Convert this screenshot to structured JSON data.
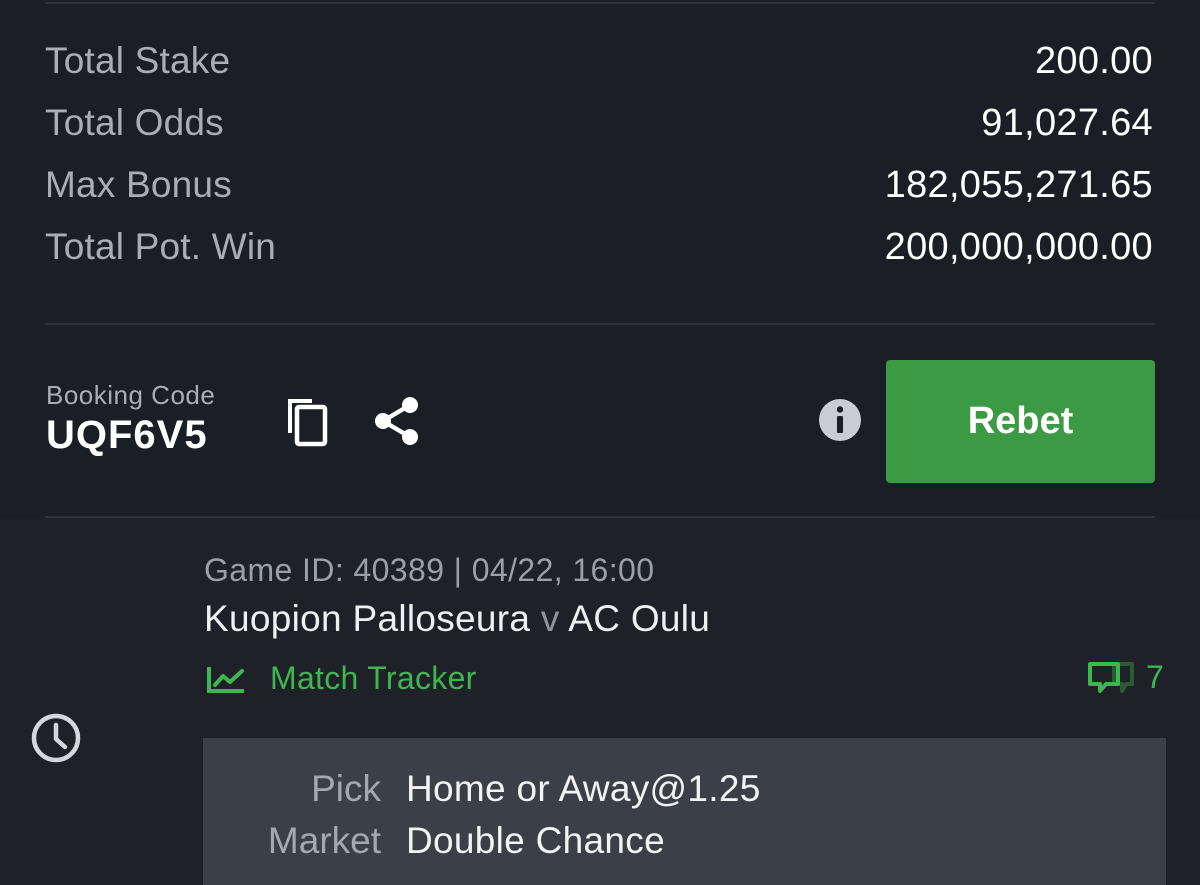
{
  "summary": {
    "rows": [
      {
        "label": "Total Stake",
        "value": "200.00"
      },
      {
        "label": "Total Odds",
        "value": "91,027.64"
      },
      {
        "label": "Max Bonus",
        "value": "182,055,271.65"
      },
      {
        "label": "Total Pot. Win",
        "value": "200,000,000.00"
      }
    ]
  },
  "booking": {
    "label": "Booking Code",
    "code": "UQF6V5"
  },
  "actions": {
    "rebet_label": "Rebet"
  },
  "selection": {
    "game_meta": "Game ID: 40389 | 04/22, 16:00",
    "home_team": "Kuopion Palloseura",
    "vs": "v",
    "away_team": "AC Oulu",
    "tracker_label": "Match Tracker",
    "comment_count": "7",
    "pick_key": "Pick",
    "pick_value": "Home or Away@1.25",
    "market_key": "Market",
    "market_value": "Double Chance"
  },
  "colors": {
    "background": "#1b1e24",
    "accent_green": "#3b9a43",
    "tracker_green": "#3fb74f",
    "pick_box": "#3b3f48"
  },
  "icons": [
    "copy-icon",
    "share-icon",
    "info-icon",
    "clock-icon",
    "match-tracker-icon",
    "comments-icon"
  ]
}
